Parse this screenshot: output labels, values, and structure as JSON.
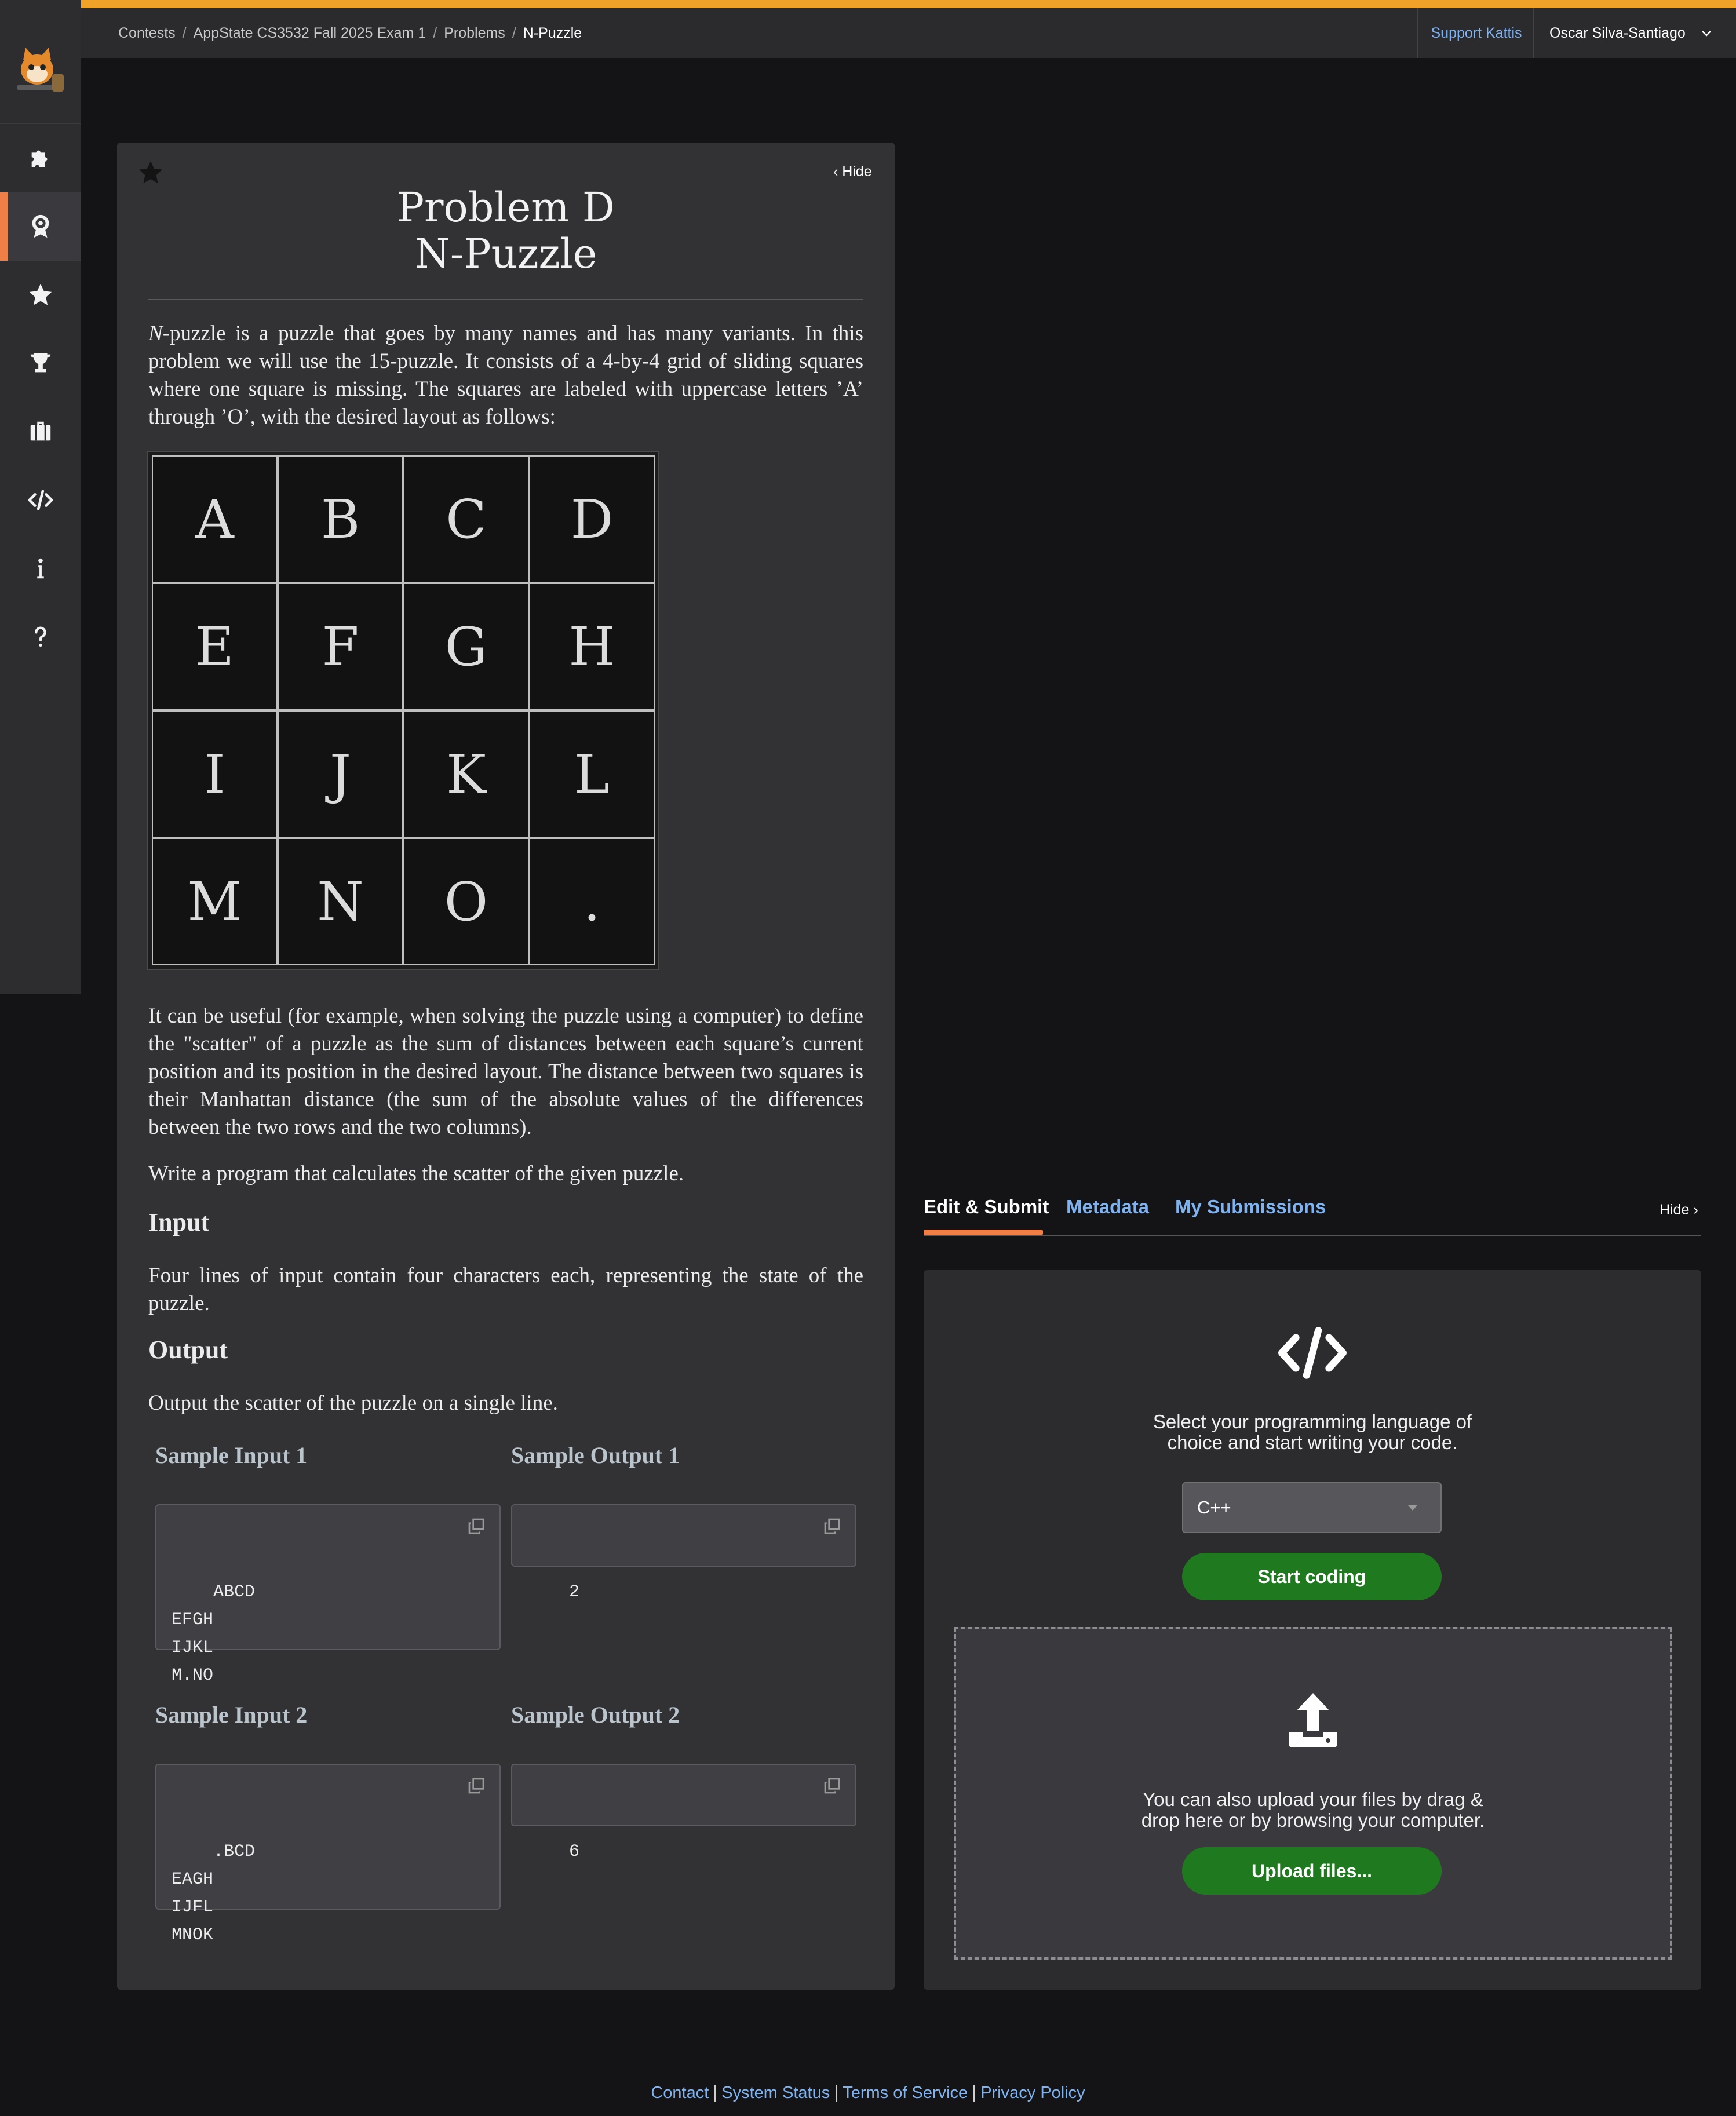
{
  "topbar": {
    "breadcrumb": [
      "Contests",
      "AppState CS3532 Fall 2025 Exam 1",
      "Problems",
      "N-Puzzle"
    ],
    "support": "Support Kattis",
    "user": "Oscar Silva-Santiago"
  },
  "sidebar": {
    "items": [
      {
        "icon": "puzzle-icon"
      },
      {
        "icon": "badge-icon",
        "active": true
      },
      {
        "icon": "star-icon"
      },
      {
        "icon": "trophy-icon"
      },
      {
        "icon": "briefcase-icon"
      },
      {
        "icon": "code-icon"
      },
      {
        "icon": "info-icon"
      },
      {
        "icon": "help-icon"
      }
    ]
  },
  "problem": {
    "hide": "Hide",
    "title_line1": "Problem D",
    "title_line2": "N-Puzzle",
    "intro_n": "N",
    "intro_rest": "-puzzle is a puzzle that goes by many names and has many variants. In this problem we will use the 15-puzzle. It consists of a 4-by-4 grid of sliding squares where one square is missing. The squares are labeled with uppercase letters ’A’ through ’O’, with the desired layout as follows:",
    "grid": [
      "A",
      "B",
      "C",
      "D",
      "E",
      "F",
      "G",
      "H",
      "I",
      "J",
      "K",
      "L",
      "M",
      "N",
      "O",
      "."
    ],
    "para2": "It can be useful (for example, when solving the puzzle using a computer) to define the \"scatter\" of a puzzle as the sum of distances between each square’s current position and its position in the desired layout. The distance between two squares is their Manhattan distance (the sum of the absolute values of the differences between the two rows and the two columns).",
    "para3": "Write a program that calculates the scatter of the given puzzle.",
    "input_heading": "Input",
    "input_text": "Four lines of input contain four characters each, representing the state of the puzzle.",
    "output_heading": "Output",
    "output_text": "Output the scatter of the puzzle on a single line.",
    "samples": [
      {
        "in_label": "Sample Input 1",
        "out_label": "Sample Output 1",
        "input": "ABCD\nEFGH\nIJKL\nM.NO",
        "output": "2"
      },
      {
        "in_label": "Sample Input 2",
        "out_label": "Sample Output 2",
        "input": ".BCD\nEAGH\nIJFL\nMNOK",
        "output": "6"
      }
    ]
  },
  "submit": {
    "tabs": [
      "Edit & Submit",
      "Metadata",
      "My Submissions"
    ],
    "hide": "Hide",
    "prompt_line1": "Select your programming language of",
    "prompt_line2": "choice and start writing your code.",
    "language": "C++",
    "start_button": "Start coding",
    "upload_line1": "You can also upload your files by drag &",
    "upload_line2": "drop here or by browsing your computer.",
    "upload_button": "Upload files..."
  },
  "footer": {
    "links": [
      "Contact",
      "System Status",
      "Terms of Service",
      "Privacy Policy"
    ]
  },
  "colors": {
    "accent": "#f0a229",
    "active_tab": "#f07f47",
    "link": "#7fb2f0",
    "button": "#1f7a1f"
  }
}
